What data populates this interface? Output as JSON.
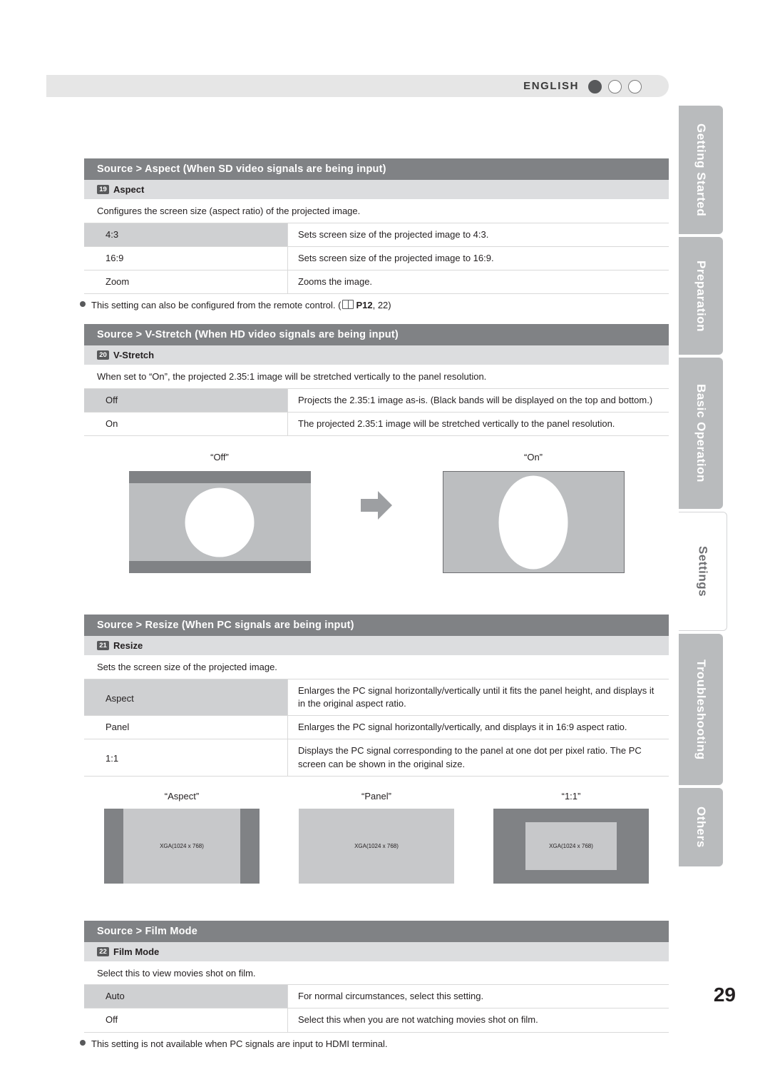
{
  "header": {
    "language": "ENGLISH",
    "dots": [
      "filled",
      "empty",
      "empty"
    ]
  },
  "side_tabs": [
    {
      "label": "Getting Started",
      "active": false
    },
    {
      "label": "Preparation",
      "active": false
    },
    {
      "label": "Basic Operation",
      "active": false
    },
    {
      "label": "Settings",
      "active": true
    },
    {
      "label": "Troubleshooting",
      "active": false
    },
    {
      "label": "Others",
      "active": false
    }
  ],
  "page_number": "29",
  "sections": [
    {
      "title": "Source > Aspect (When SD video signals are being input)",
      "sub_number": "19",
      "sub_label": "Aspect",
      "description": "Configures the screen size (aspect ratio) of the projected image.",
      "rows": [
        {
          "key": "4:3",
          "value": "Sets screen size of the projected image to 4:3.",
          "shaded": true
        },
        {
          "key": "16:9",
          "value": "Sets screen size of the projected image to 16:9.",
          "shaded": false
        },
        {
          "key": "Zoom",
          "value": "Zooms the image.",
          "shaded": false
        }
      ],
      "note_pre": "This setting can also be configured from the remote control. (",
      "note_ref": "P12",
      "note_post": ", 22)"
    },
    {
      "title": "Source > V-Stretch (When HD video signals are being input)",
      "sub_number": "20",
      "sub_label": "V-Stretch",
      "description": "When set to “On”, the projected 2.35:1 image will be stretched vertically to the panel resolution.",
      "rows": [
        {
          "key": "Off",
          "value": "Projects the 2.35:1 image as-is. (Black bands will be displayed on the top and bottom.)",
          "shaded": true
        },
        {
          "key": "On",
          "value": "The projected 2.35:1 image will be stretched vertically to the panel resolution.",
          "shaded": false
        }
      ]
    },
    {
      "title": "Source > Resize (When PC signals are being input)",
      "sub_number": "21",
      "sub_label": "Resize",
      "description": "Sets the screen size of the projected image.",
      "rows": [
        {
          "key": "Aspect",
          "value": "Enlarges the PC signal horizontally/vertically until it fits the panel height, and displays it in the original aspect ratio.",
          "shaded": true
        },
        {
          "key": "Panel",
          "value": "Enlarges the PC signal horizontally/vertically, and displays it in 16:9 aspect ratio.",
          "shaded": false
        },
        {
          "key": "1:1",
          "value": "Displays the PC signal corresponding to the panel at one dot per pixel ratio. The PC screen can be shown in the original size.",
          "shaded": false
        }
      ]
    },
    {
      "title": "Source > Film Mode",
      "sub_number": "22",
      "sub_label": "Film Mode",
      "description": "Select this to view movies shot on film.",
      "rows": [
        {
          "key": "Auto",
          "value": "For normal circumstances, select this setting.",
          "shaded": true
        },
        {
          "key": "Off",
          "value": "Select this when you are not watching movies shot on film.",
          "shaded": false
        }
      ],
      "note_pre": "This setting is not available when PC signals are input to HDMI terminal.",
      "note_ref": "",
      "note_post": ""
    }
  ],
  "figures": {
    "vstretch": {
      "left_caption": "“Off”",
      "right_caption": "“On”"
    },
    "resize": [
      {
        "caption": "“Aspect”",
        "label": "XGA(1024 x 768)"
      },
      {
        "caption": "“Panel”",
        "label": "XGA(1024 x 768)"
      },
      {
        "caption": "“1:1”",
        "label": "XGA(1024 x 768)"
      }
    ]
  }
}
